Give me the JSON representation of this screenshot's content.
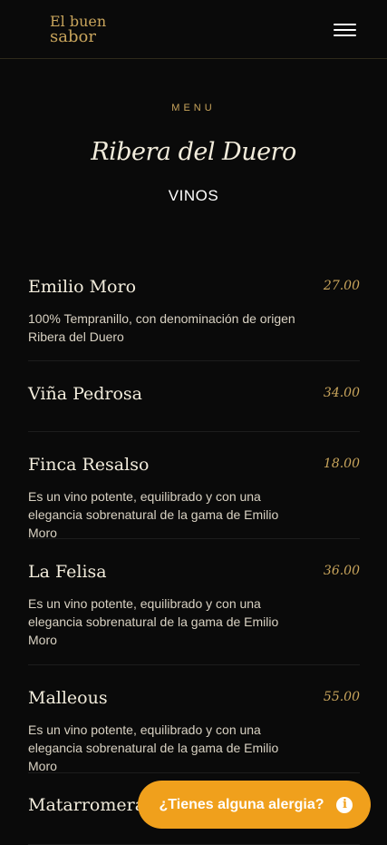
{
  "header": {
    "logo_line1": "El buen",
    "logo_line2": "sabor",
    "menu_icon": "hamburger-icon"
  },
  "section": {
    "eyebrow": "MENU",
    "title": "Ribera del Duero",
    "subtitle": "VINOS"
  },
  "items": [
    {
      "name": "Emilio Moro",
      "price": "27.00",
      "desc_line1": "100% Tempranillo, con denominación de origen",
      "desc_line2": "Ribera del Duero",
      "desc_line3": ""
    },
    {
      "name": "Viña Pedrosa",
      "price": "34.00",
      "desc_line1": "",
      "desc_line2": "",
      "desc_line3": ""
    },
    {
      "name": "Finca Resalso",
      "price": "18.00",
      "desc_line1": "Es un vino potente, equilibrado y con una",
      "desc_line2": "elegancia sobrenatural de la gama de Emilio Moro",
      "desc_line3": ""
    },
    {
      "name": "La Felisa",
      "price": "36.00",
      "desc_line1": "Es un vino potente, equilibrado y con una",
      "desc_line2": "elegancia sobrenatural de la gama de Emilio",
      "desc_line3": "Moro"
    },
    {
      "name": "Malleous",
      "price": "55.00",
      "desc_line1": "Es un vino potente, equilibrado y con una",
      "desc_line2": "elegancia sobrenatural de la gama de Emilio Moro",
      "desc_line3": ""
    },
    {
      "name": "Matarromera",
      "price": "",
      "desc_line1": "",
      "desc_line2": "",
      "desc_line3": ""
    }
  ],
  "allergy_button": {
    "label": "¿Tienes alguna alergia?",
    "icon": "info-icon",
    "color": "#f0a01c"
  },
  "colors": {
    "background": "#0a0a0a",
    "accent": "#c9a55c",
    "text": "#f2ecdc"
  }
}
